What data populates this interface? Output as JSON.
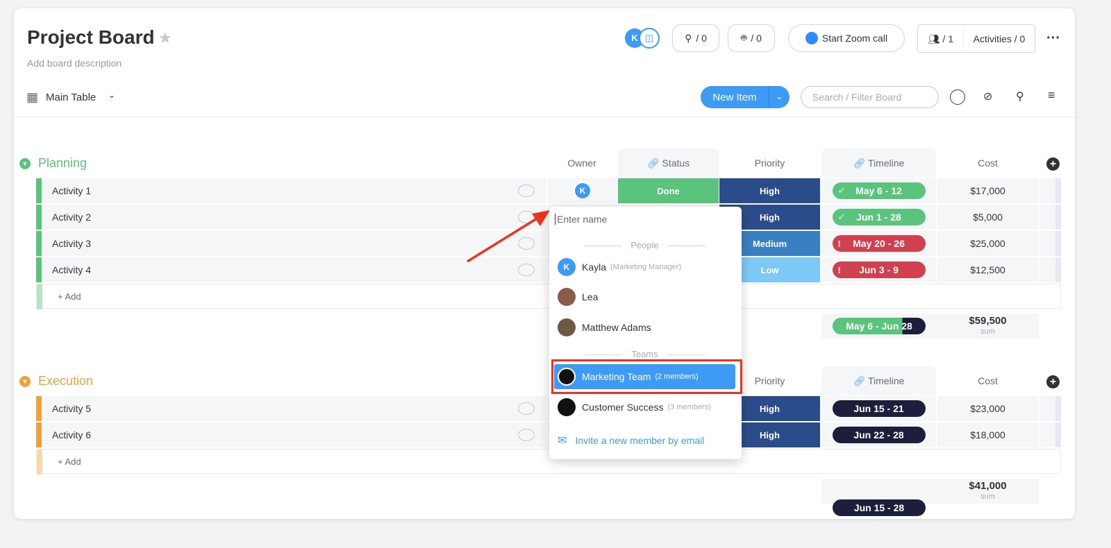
{
  "board": {
    "title": "Project Board",
    "description": "Add board description"
  },
  "header": {
    "avatar_initial": "K",
    "integrations_count": "/ 0",
    "automations_count": "/ 0",
    "zoom_label": "Start Zoom call",
    "members_count": "/ 1",
    "activities_label": "Activities / 0"
  },
  "toolbar": {
    "view_label": "Main Table",
    "new_item_label": "New Item",
    "search_placeholder": "Search / Filter Board"
  },
  "columns": {
    "owner": "Owner",
    "status": "Status",
    "priority": "Priority",
    "timeline": "Timeline",
    "cost": "Cost"
  },
  "colors": {
    "done": "#5ac47d",
    "high": "#2b4c8b",
    "medium": "#3a7fc1",
    "low": "#7ec8f7",
    "overdue": "#d0404e",
    "planning": "#5ac47d",
    "execution": "#f2a03d",
    "accent": "#3d9af5"
  },
  "groups": [
    {
      "name": "Planning",
      "add_label": "+ Add",
      "rows": [
        {
          "name": "Activity 1",
          "owner": "K",
          "status": "Done",
          "priority": "High",
          "timeline": "May 6 - 12",
          "timeline_state": "done",
          "cost": "$17,000"
        },
        {
          "name": "Activity 2",
          "owner": "",
          "status": "",
          "priority": "High",
          "timeline": "Jun 1 - 28",
          "timeline_state": "done",
          "cost": "$5,000"
        },
        {
          "name": "Activity 3",
          "owner": "",
          "status": "",
          "priority": "Medium",
          "timeline": "May 20 - 26",
          "timeline_state": "overdue",
          "cost": "$25,000"
        },
        {
          "name": "Activity 4",
          "owner": "",
          "status": "",
          "priority": "Low",
          "timeline": "Jun 3 - 9",
          "timeline_state": "overdue",
          "cost": "$12,500"
        }
      ],
      "summary": {
        "timeline": "May 6 - Jun 28",
        "cost": "$59,500",
        "cost_label": "sum"
      }
    },
    {
      "name": "Execution",
      "add_label": "+ Add",
      "rows": [
        {
          "name": "Activity 5",
          "priority": "High",
          "timeline": "Jun 15 - 21",
          "cost": "$23,000"
        },
        {
          "name": "Activity 6",
          "priority": "High",
          "timeline": "Jun 22 - 28",
          "cost": "$18,000"
        }
      ],
      "summary": {
        "timeline": "Jun 15 - 28",
        "cost": "$41,000",
        "cost_label": "sum"
      }
    }
  ],
  "dropdown": {
    "placeholder": "Enter name",
    "people_label": "People",
    "teams_label": "Teams",
    "people": [
      {
        "name": "Kayla",
        "role": "(Marketing Manager)",
        "initial": "K"
      },
      {
        "name": "Lea",
        "role": ""
      },
      {
        "name": "Matthew Adams",
        "role": ""
      }
    ],
    "teams": [
      {
        "name": "Marketing Team",
        "members": "(2 members)",
        "selected": true
      },
      {
        "name": "Customer Success",
        "members": "(3 members)"
      }
    ],
    "invite_label": "Invite a new member by email"
  }
}
